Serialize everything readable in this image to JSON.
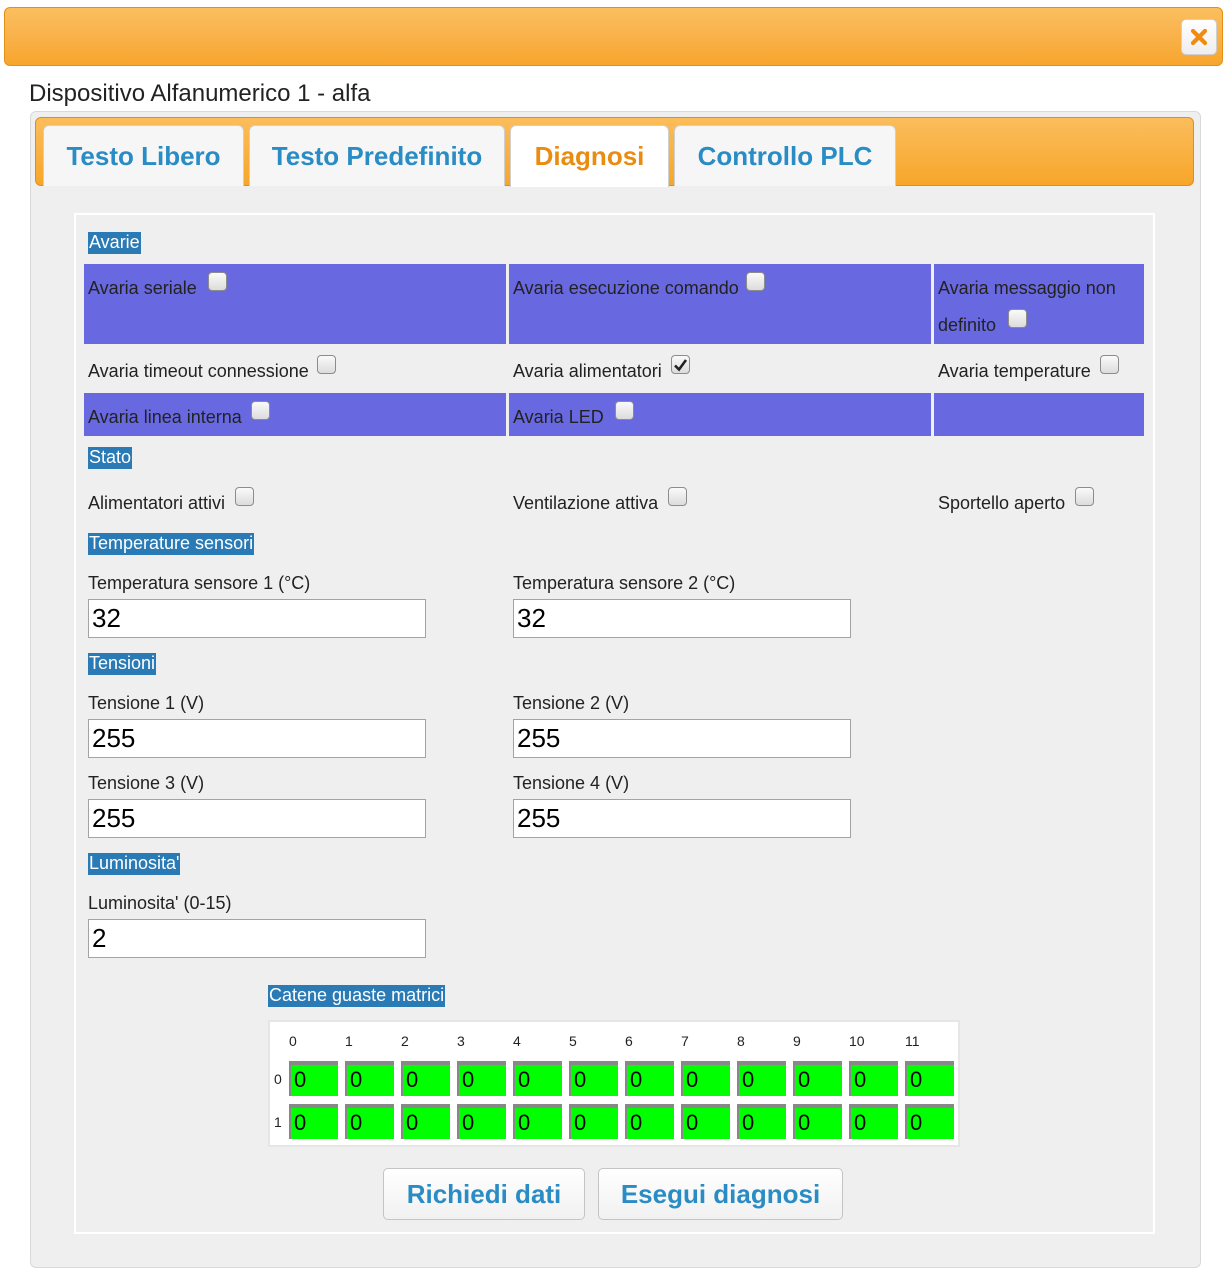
{
  "dialog": {
    "close_icon": "close-x-icon",
    "accent": "#f9b048",
    "device_title": "Dispositivo Alfanumerico 1 - alfa"
  },
  "tabs": [
    {
      "label": "Testo Libero",
      "active": false
    },
    {
      "label": "Testo Predefinito",
      "active": false
    },
    {
      "label": "Diagnosi",
      "active": true
    },
    {
      "label": "Controllo PLC",
      "active": false
    }
  ],
  "avarie": {
    "title": "Avarie",
    "items": [
      {
        "label": "Avaria seriale",
        "checked": false
      },
      {
        "label": "Avaria esecuzione comando",
        "checked": false
      },
      {
        "label_line1": "Avaria messaggio non",
        "label_line2": "definito",
        "checked": false
      },
      {
        "label": "Avaria timeout connessione",
        "checked": false
      },
      {
        "label": "Avaria alimentatori",
        "checked": true
      },
      {
        "label": "Avaria temperature",
        "checked": false
      },
      {
        "label": "Avaria linea interna",
        "checked": false
      },
      {
        "label": "Avaria LED",
        "checked": false
      }
    ]
  },
  "stato": {
    "title": "Stato",
    "items": [
      {
        "label": "Alimentatori attivi",
        "checked": false
      },
      {
        "label": "Ventilazione attiva",
        "checked": false
      },
      {
        "label": "Sportello aperto",
        "checked": false
      }
    ]
  },
  "temperature": {
    "title": "Temperature sensori",
    "fields": [
      {
        "label": "Temperatura sensore 1 (°C)",
        "value": "32"
      },
      {
        "label": "Temperatura sensore 2 (°C)",
        "value": "32"
      }
    ]
  },
  "tensioni": {
    "title": "Tensioni",
    "fields": [
      {
        "label": "Tensione 1 (V)",
        "value": "255"
      },
      {
        "label": "Tensione 2 (V)",
        "value": "255"
      },
      {
        "label": "Tensione 3 (V)",
        "value": "255"
      },
      {
        "label": "Tensione 4 (V)",
        "value": "255"
      }
    ]
  },
  "luminosita": {
    "title": "Luminosita'",
    "field": {
      "label": "Luminosita' (0-15)",
      "value": "2"
    }
  },
  "catene": {
    "title": "Catene guaste matrici",
    "columns": [
      "0",
      "1",
      "2",
      "3",
      "4",
      "5",
      "6",
      "7",
      "8",
      "9",
      "10",
      "11"
    ],
    "rows": [
      {
        "label": "0",
        "values": [
          "0",
          "0",
          "0",
          "0",
          "0",
          "0",
          "0",
          "0",
          "0",
          "0",
          "0",
          "0"
        ]
      },
      {
        "label": "1",
        "values": [
          "0",
          "0",
          "0",
          "0",
          "0",
          "0",
          "0",
          "0",
          "0",
          "0",
          "0",
          "0"
        ]
      }
    ],
    "cell_color": "#00ff00"
  },
  "actions": {
    "richiedi_label": "Richiedi dati",
    "esegui_label": "Esegui diagnosi"
  }
}
